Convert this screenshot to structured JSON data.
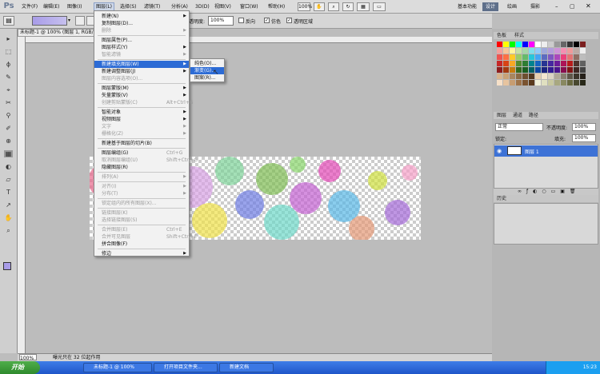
{
  "menubar": {
    "items": [
      "文件(F)",
      "编辑(E)",
      "图像(I)",
      "图层(L)",
      "选择(S)",
      "滤镜(T)",
      "分析(A)",
      "3D(D)",
      "视图(V)",
      "窗口(W)",
      "帮助(H)"
    ],
    "active_index": 3,
    "workspaces": [
      "基本功能",
      "设计",
      "绘画",
      "摄影"
    ],
    "active_workspace": 1,
    "zoom_label": "100%"
  },
  "options": {
    "opacity_label": "透明度:",
    "opacity_value": "100%",
    "reverse_label": "反向",
    "dither_label": "仿色",
    "transparency_label": "透明区域"
  },
  "document": {
    "tab_title": "未标题-1 @ 100% (图层 1, RGB/8)",
    "zoom": "100%",
    "status": "曝光只在 32 位起作用"
  },
  "layer_menu": {
    "items": [
      {
        "label": "新建(N)",
        "arrow": true,
        "disabled": false
      },
      {
        "label": "复制图层(D)...",
        "disabled": false
      },
      {
        "label": "删除",
        "arrow": true,
        "disabled": true
      },
      {
        "sep": true
      },
      {
        "label": "图层属性(P)...",
        "disabled": false
      },
      {
        "label": "图层样式(Y)",
        "arrow": true,
        "disabled": false
      },
      {
        "label": "智能滤镜",
        "arrow": true,
        "disabled": true
      },
      {
        "sep": true
      },
      {
        "label": "新建填充图层(W)",
        "arrow": true,
        "disabled": false,
        "highlight": true
      },
      {
        "label": "新建调整图层(J)",
        "arrow": true,
        "disabled": false
      },
      {
        "label": "图层内容选项(O)...",
        "disabled": true
      },
      {
        "sep": true
      },
      {
        "label": "图层蒙版(M)",
        "arrow": true,
        "disabled": false
      },
      {
        "label": "矢量蒙版(V)",
        "arrow": true,
        "disabled": false
      },
      {
        "label": "创建剪贴蒙版(C)",
        "shortcut": "Alt+Ctrl+G",
        "disabled": true
      },
      {
        "sep": true
      },
      {
        "label": "智能对象",
        "arrow": true,
        "disabled": false
      },
      {
        "label": "视频图层",
        "arrow": true,
        "disabled": false
      },
      {
        "label": "文字",
        "arrow": true,
        "disabled": true
      },
      {
        "label": "栅格化(Z)",
        "arrow": true,
        "disabled": true
      },
      {
        "sep": true
      },
      {
        "label": "新建基于图层的切片(B)",
        "disabled": false
      },
      {
        "sep": true
      },
      {
        "label": "图层编组(G)",
        "shortcut": "Ctrl+G",
        "disabled": false
      },
      {
        "label": "取消图层编组(U)",
        "shortcut": "Shift+Ctrl+G",
        "disabled": true
      },
      {
        "label": "隐藏图层(R)",
        "disabled": false
      },
      {
        "sep": true
      },
      {
        "label": "排列(A)",
        "arrow": true,
        "disabled": true
      },
      {
        "sep": true
      },
      {
        "label": "对齐(I)",
        "arrow": true,
        "disabled": true
      },
      {
        "label": "分布(T)",
        "arrow": true,
        "disabled": true
      },
      {
        "sep": true
      },
      {
        "label": "锁定组内的所有图层(X)...",
        "disabled": true
      },
      {
        "sep": true
      },
      {
        "label": "链接图层(K)",
        "disabled": true
      },
      {
        "label": "选择链接图层(S)",
        "disabled": true
      },
      {
        "sep": true
      },
      {
        "label": "合并图层(E)",
        "shortcut": "Ctrl+E",
        "disabled": true
      },
      {
        "label": "合并可见图层",
        "shortcut": "Shift+Ctrl+E",
        "disabled": true
      },
      {
        "label": "拼合图像(F)",
        "disabled": false
      },
      {
        "sep": true
      },
      {
        "label": "修边",
        "arrow": true,
        "disabled": false
      }
    ]
  },
  "fill_submenu": {
    "items": [
      "纯色(O)...",
      "渐变(G)...",
      "图案(R)..."
    ],
    "highlight_index": 1
  },
  "swatches_panel": {
    "tabs": [
      "色板",
      "样式"
    ]
  },
  "layers_panel": {
    "tabs": [
      "图层",
      "通道",
      "路径"
    ],
    "blend_mode": "正常",
    "opacity_label": "不透明度:",
    "opacity_value": "100%",
    "lock_label": "锁定:",
    "fill_label": "填充:",
    "fill_value": "100%",
    "layer_name": "图层 1"
  },
  "history_panel": {
    "tabs": [
      "历史"
    ]
  },
  "taskbar": {
    "start": "开始",
    "tasks": [
      "未标题-1 @ 100%",
      "打开项目文件夹...",
      "新建文档"
    ],
    "clock": "15:23"
  },
  "colors": {
    "menu_highlight": "#2c6bd5",
    "workspace_active": "#5e6f8a",
    "foreground": "#a89ce8"
  }
}
